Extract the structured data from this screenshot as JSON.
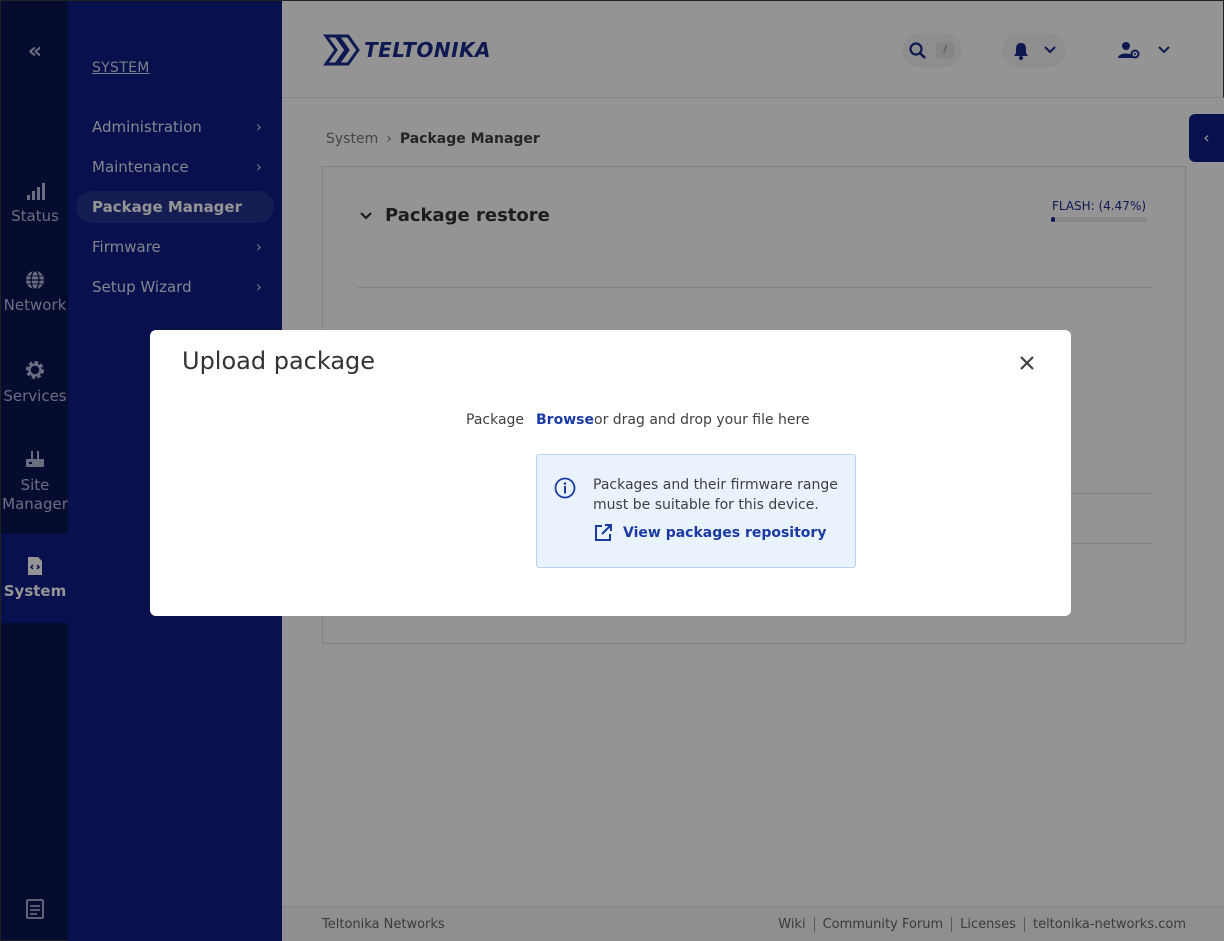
{
  "rail": {
    "items": [
      {
        "label": "Status",
        "icon": "signal-icon"
      },
      {
        "label": "Network",
        "icon": "globe-icon"
      },
      {
        "label": "Services",
        "icon": "gear-icon"
      },
      {
        "label": "Site Manager",
        "icon": "router-icon"
      },
      {
        "label": "System",
        "icon": "system-doc-icon",
        "active": true
      }
    ]
  },
  "subnav": {
    "heading": "SYSTEM",
    "items": [
      {
        "label": "Administration"
      },
      {
        "label": "Maintenance"
      },
      {
        "label": "Package Manager"
      },
      {
        "label": "Firmware"
      },
      {
        "label": "Setup Wizard"
      }
    ]
  },
  "header": {
    "logo_text": "TELTONIKA",
    "search_shortcut": "/"
  },
  "breadcrumb": {
    "parent": "System",
    "current": "Package Manager"
  },
  "card": {
    "title": "Package restore",
    "flash_label": "FLASH: (4.47%)",
    "flash_percent": 4.47
  },
  "modal": {
    "title": "Upload package",
    "field_label": "Package",
    "browse_label": "Browse",
    "drag_text": "or drag and drop your file here",
    "info_text": "Packages and their firmware range must be suitable for this device.",
    "repo_link": "View packages repository"
  },
  "footer": {
    "brand": "Teltonika Networks",
    "links": [
      "Wiki",
      "Community Forum",
      "Licenses",
      "teltonika-networks.com"
    ]
  },
  "colors": {
    "rail_bg": "#0b1551",
    "subnav_bg": "#0f1e86",
    "accent": "#1a3aa6",
    "info_bg": "#eaf2fd"
  }
}
